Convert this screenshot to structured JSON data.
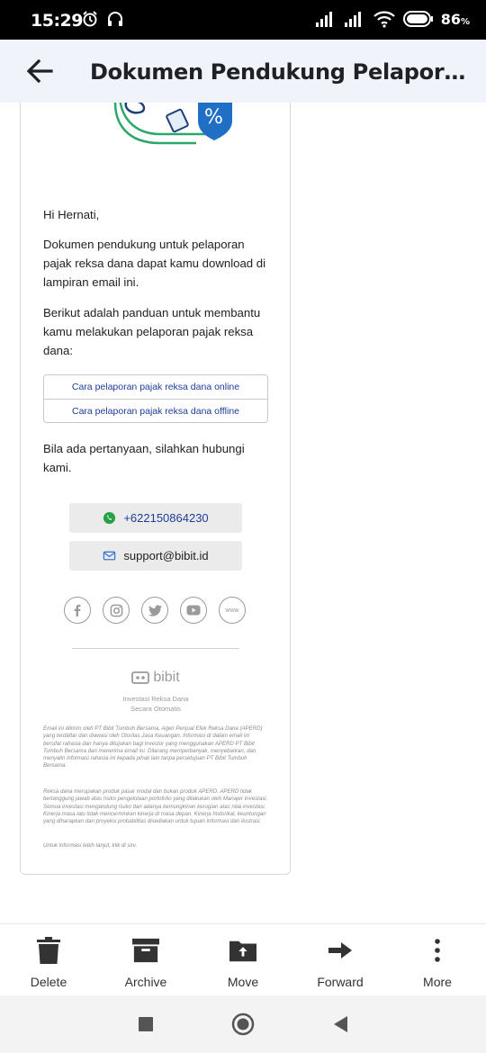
{
  "status_bar": {
    "time": "15:29",
    "battery": "86",
    "battery_unit": "%"
  },
  "app_bar": {
    "title": "Dokumen Pendukung Pelaporan P..."
  },
  "email": {
    "greeting": "Hi Hernati,",
    "para1": "Dokumen pendukung untuk pelaporan pajak reksa dana dapat kamu download di lampiran email ini.",
    "para2": "Berikut adalah panduan untuk membantu kamu melakukan pelaporan pajak reksa dana:",
    "guide_links": [
      "Cara pelaporan pajak reksa dana online",
      "Cara pelaporan pajak reksa dana offline"
    ],
    "para3": "Bila ada pertanyaan, silahkan hubungi kami.",
    "phone": "+622150864230",
    "email_address": "support@bibit.id",
    "social_icons": [
      "facebook-icon",
      "instagram-icon",
      "twitter-icon",
      "youtube-icon",
      "www-icon"
    ],
    "www_label": "www",
    "brand": "bibit",
    "tagline_1": "Investasi Reksa Dana",
    "tagline_2": "Secara Otomatis",
    "disclaimer_1": "Email ini dikirim oleh PT Bibit Tumbuh Bersama, Agen Penjual Efek Reksa Dana (APERD) yang terdaftar dan diawasi oleh Otoritas Jasa Keuangan. Informasi di dalam email ini bersifat rahasia dan hanya ditujukan bagi investor yang menggunakan APERD PT Bibit Tumbuh Bersama dan menerima email ini. Dilarang memperbanyak, menyebarkan, dan menyalin informasi rahasia ini kepada pihak lain tanpa persetujuan PT Bibit Tumbuh Bersama.",
    "disclaimer_2": "Reksa dana merupakan produk pasar modal dan bukan produk APERD. APERD tidak bertanggung jawab atas risiko pengelolaan portofolio yang dilakukan oleh Manajer Investasi. Semua investasi mengandung risiko dan adanya kemungkinan kerugian atas nilai investasi. Kinerja masa lalu tidak mencerminkan kinerja di masa depan. Kinerja historikal, keuntungan yang diharapkan dan proyeksi probabilitas disediakan untuk tujuan informasi dan ilustrasi.",
    "disclaimer_3": "Untuk informasi lebih lanjut, klik di sini."
  },
  "toolbar": {
    "delete": "Delete",
    "archive": "Archive",
    "move": "Move",
    "forward": "Forward",
    "more": "More"
  },
  "colors": {
    "accent_blue": "#1f3d99",
    "whatsapp_green": "#25a244",
    "app_bar_bg": "#f1f3fb"
  }
}
